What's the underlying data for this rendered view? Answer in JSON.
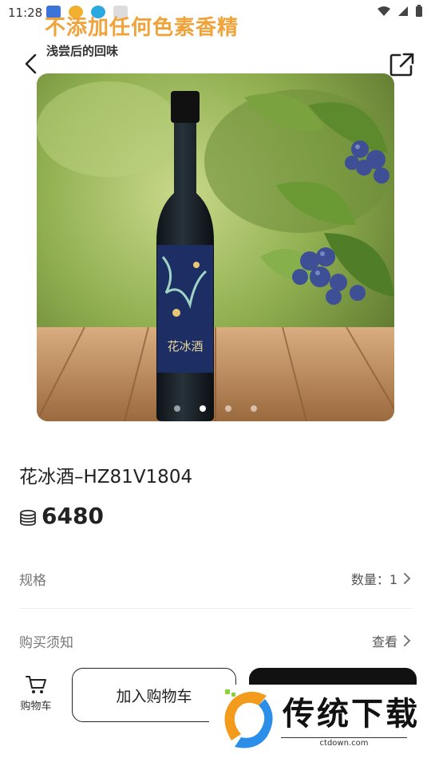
{
  "status_bar": {
    "time": "11:28",
    "icons": [
      "wifi-icon",
      "signal-icon",
      "battery-icon"
    ]
  },
  "header": {
    "slogan": "不添加任何色素香精",
    "subtitle": "浅尝后的回味"
  },
  "carousel": {
    "slide_count": 4,
    "active_index": 1,
    "bottle_label": "花冰酒"
  },
  "product": {
    "title": "花冰酒–HZ81V1804",
    "price": "6480",
    "price_icon": "coin-stack-icon"
  },
  "rows": [
    {
      "label": "规格",
      "value": "数量：1"
    },
    {
      "label": "购买须知",
      "value": "查看"
    }
  ],
  "bottom_bar": {
    "cart_label": "购物车",
    "add_to_cart": "加入购物车"
  },
  "watermark": {
    "logo_text": "传统下载",
    "url": "ctdown.com"
  },
  "colors": {
    "accent": "#f0a33a",
    "primary_button": "#111111"
  }
}
